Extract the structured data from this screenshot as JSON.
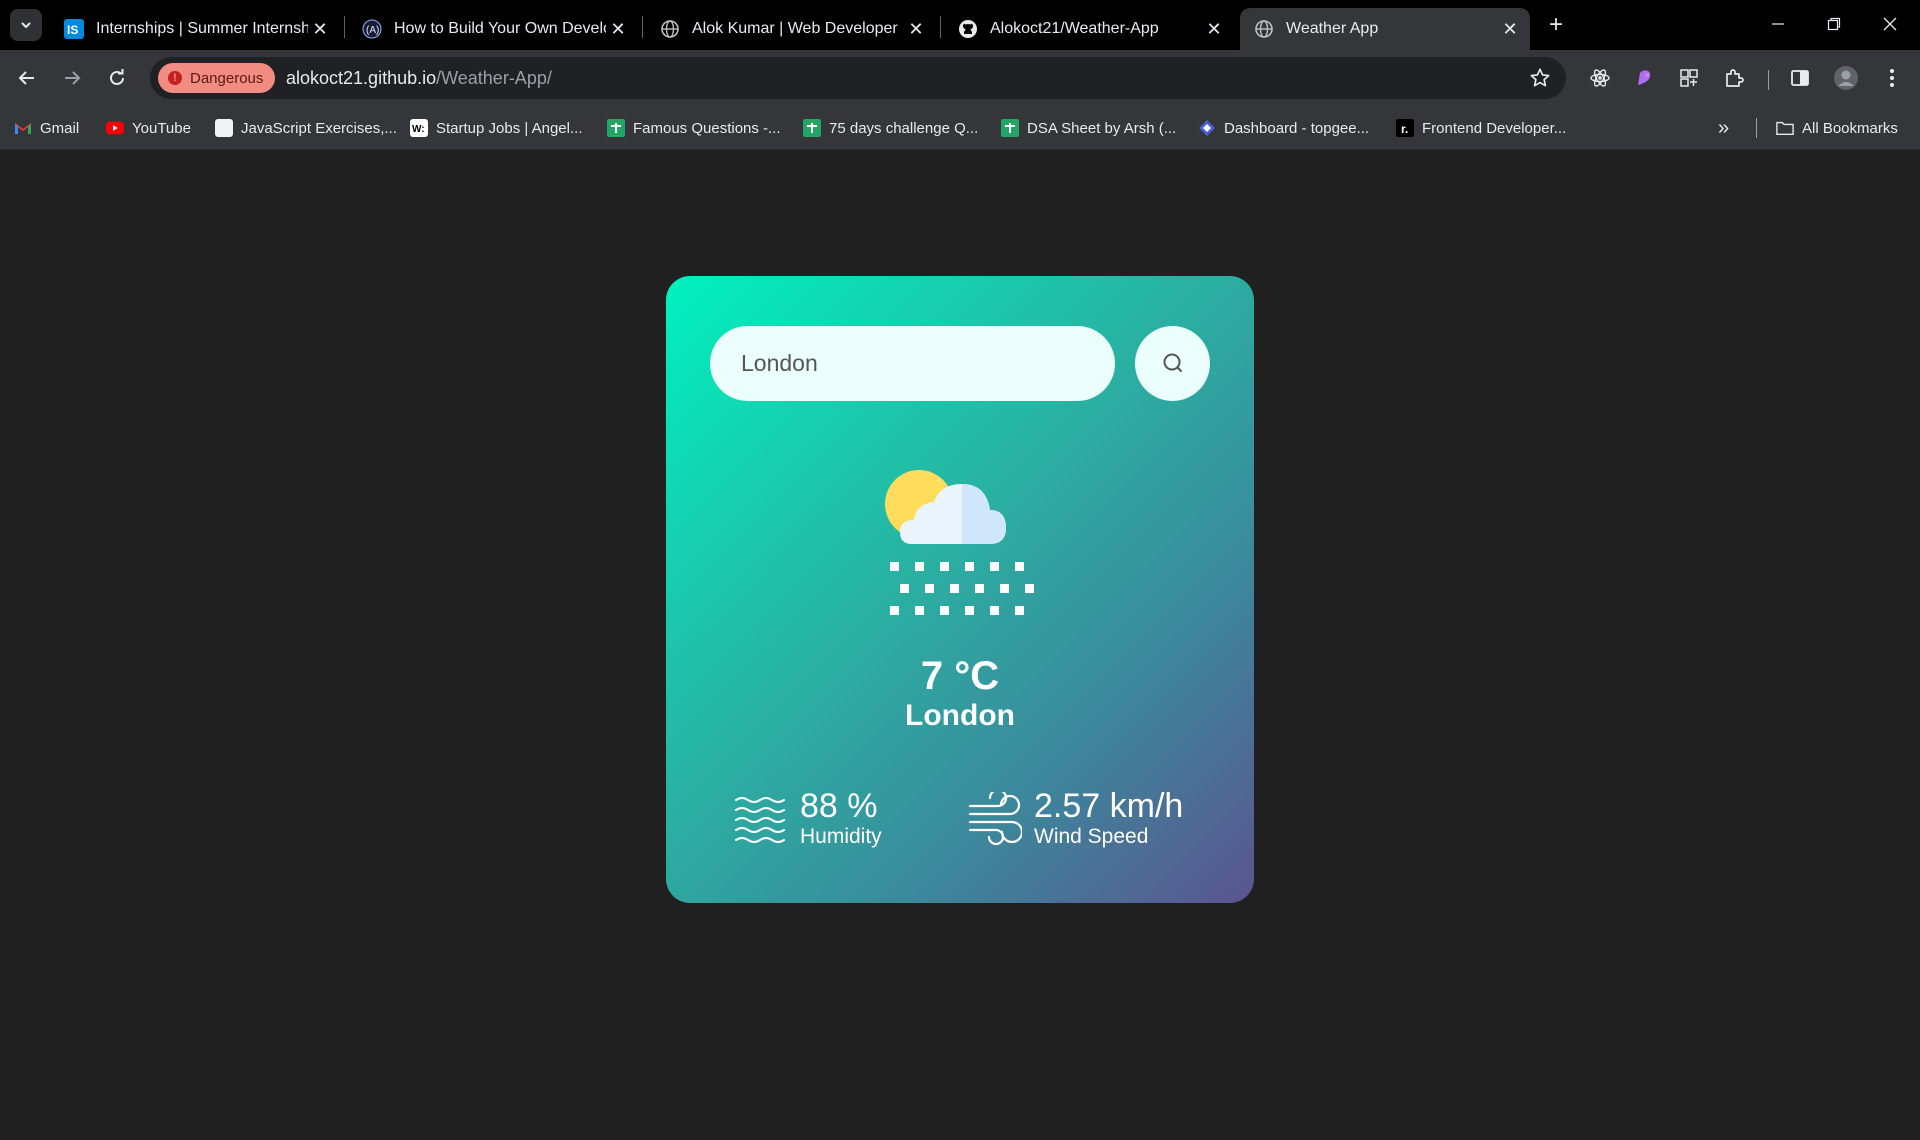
{
  "browser": {
    "tabs": [
      {
        "title": "Internships | Summer Internship",
        "favicon": "internshala-icon",
        "active": false
      },
      {
        "title": "How to Build Your Own Develop",
        "favicon": "code-icon",
        "active": false
      },
      {
        "title": "Alok Kumar | Web Developer",
        "favicon": "globe-icon",
        "active": false
      },
      {
        "title": "Alokoct21/Weather-App",
        "favicon": "github-icon",
        "active": false
      },
      {
        "title": "Weather App",
        "favicon": "globe-icon",
        "active": true
      }
    ],
    "security_badge": "Dangerous",
    "url_host": "alokoct21.github.io",
    "url_path": "/Weather-App/",
    "bookmarks": [
      {
        "label": "Gmail",
        "icon": "gmail-icon"
      },
      {
        "label": "YouTube",
        "icon": "youtube-icon"
      },
      {
        "label": "JavaScript Exercises,...",
        "icon": "page-icon"
      },
      {
        "label": "Startup Jobs | Angel...",
        "icon": "wellfound-icon"
      },
      {
        "label": "Famous Questions -...",
        "icon": "sheets-icon"
      },
      {
        "label": "75 days challenge Q...",
        "icon": "sheets-icon"
      },
      {
        "label": "DSA Sheet by Arsh (...",
        "icon": "sheets-icon"
      },
      {
        "label": "Dashboard - topgee...",
        "icon": "topgeek-icon"
      },
      {
        "label": "Frontend Developer...",
        "icon": "r-icon"
      }
    ],
    "all_bookmarks": "All Bookmarks"
  },
  "weather": {
    "search_value": "London",
    "temperature": "7 °C",
    "city": "London",
    "humidity_value": "88 %",
    "humidity_label": "Humidity",
    "wind_value": "2.57 km/h",
    "wind_label": "Wind Speed",
    "condition_icon": "snow-cloud-sun-icon"
  },
  "colors": {
    "card_gradient_start": "#00f2be",
    "card_gradient_end": "#5b548f",
    "page_bg": "#202020",
    "danger_badge": "#f28b82"
  }
}
